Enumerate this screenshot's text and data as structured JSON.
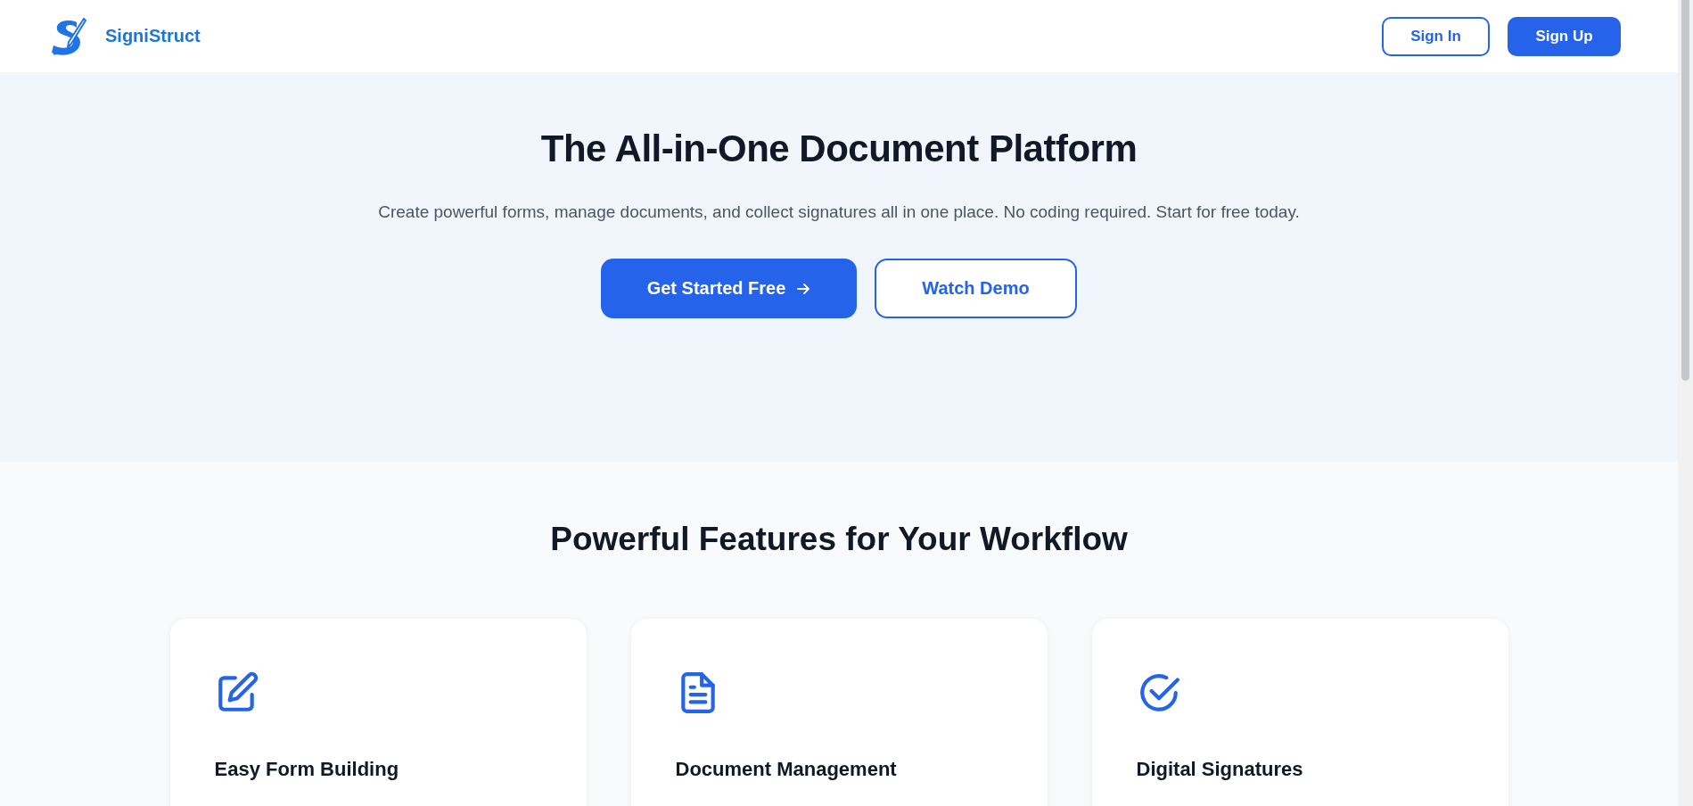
{
  "header": {
    "brand": "SigniStruct",
    "buttons": [
      {
        "label": "Sign In",
        "kind": "outline"
      },
      {
        "label": "Sign Up",
        "kind": "primary"
      }
    ]
  },
  "hero": {
    "title": "The All-in-One Document Platform",
    "subtitle": "Create powerful forms, manage documents, and collect signatures all in one place. No coding required. Start for free today.",
    "buttons": [
      {
        "label": "Get Started Free",
        "kind": "primary",
        "arrow": true
      },
      {
        "label": "Watch Demo",
        "kind": "outline",
        "arrow": false
      }
    ]
  },
  "features": {
    "heading": "Powerful Features for Your Workflow",
    "cards": [
      {
        "title": "Easy Form Building",
        "kind": "edit"
      },
      {
        "title": "Document Management",
        "kind": "document"
      },
      {
        "title": "Digital Signatures",
        "kind": "check"
      }
    ]
  }
}
